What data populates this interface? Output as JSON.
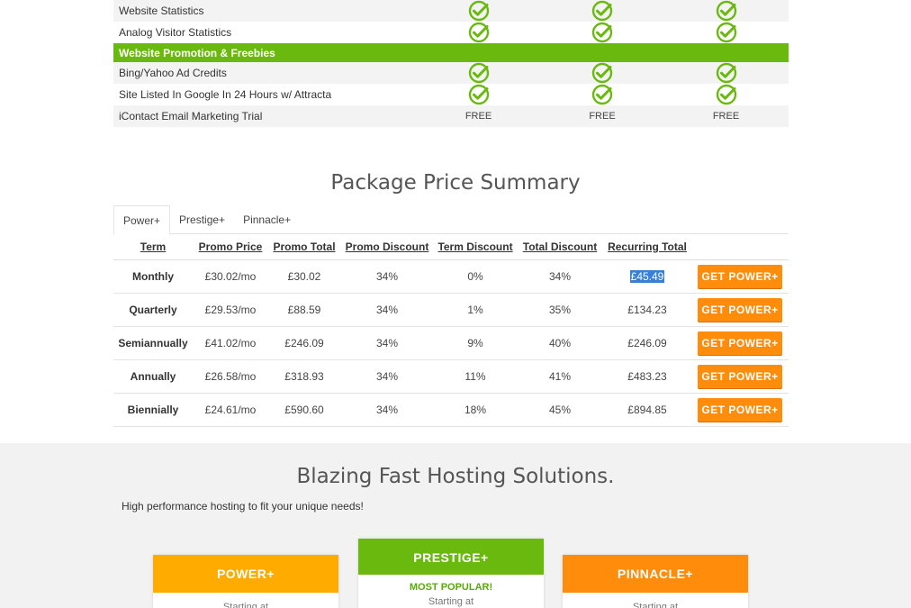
{
  "features": {
    "rows_top": [
      {
        "label": "Website Statistics",
        "cells": [
          "check",
          "check",
          "check"
        ],
        "bg": "alt"
      },
      {
        "label": "Analog Visitor Statistics",
        "cells": [
          "check",
          "check",
          "check"
        ],
        "bg": "white"
      }
    ],
    "section_label": "Website Promotion & Freebies",
    "rows_bottom": [
      {
        "label": "Bing/Yahoo Ad Credits",
        "cells": [
          "check",
          "check",
          "check"
        ],
        "bg": "alt"
      },
      {
        "label": "Site Listed In Google In 24 Hours w/ Attracta",
        "cells": [
          "check",
          "check",
          "check"
        ],
        "bg": "white"
      },
      {
        "label": "iContact Email Marketing Trial",
        "cells": [
          "FREE",
          "FREE",
          "FREE"
        ],
        "bg": "alt"
      }
    ]
  },
  "summary": {
    "title": "Package Price Summary",
    "tabs": [
      "Power+",
      "Prestige+",
      "Pinnacle+"
    ],
    "active_tab": 0,
    "columns": [
      "Term",
      "Promo Price",
      "Promo Total",
      "Promo Discount",
      "Term Discount",
      "Total Discount",
      "Recurring Total"
    ],
    "rows": [
      {
        "term": "Monthly",
        "promo_price": "£30.02/mo",
        "promo_total": "£30.02",
        "promo_discount": "34%",
        "term_discount": "0%",
        "total_discount": "34%",
        "recurring_total": "£45.49",
        "button": "GET POWER+"
      },
      {
        "term": "Quarterly",
        "promo_price": "£29.53/mo",
        "promo_total": "£88.59",
        "promo_discount": "34%",
        "term_discount": "1%",
        "total_discount": "35%",
        "recurring_total": "£134.23",
        "button": "GET POWER+"
      },
      {
        "term": "Semiannually",
        "promo_price": "£41.02/mo",
        "promo_total": "£246.09",
        "promo_discount": "34%",
        "term_discount": "9%",
        "total_discount": "40%",
        "recurring_total": "£246.09",
        "button": "GET POWER+"
      },
      {
        "term": "Annually",
        "promo_price": "£26.58/mo",
        "promo_total": "£318.93",
        "promo_discount": "34%",
        "term_discount": "11%",
        "total_discount": "41%",
        "recurring_total": "£483.23",
        "button": "GET POWER+"
      },
      {
        "term": "Biennially",
        "promo_price": "£24.61/mo",
        "promo_total": "£590.60",
        "promo_discount": "34%",
        "term_discount": "18%",
        "total_discount": "45%",
        "recurring_total": "£894.85",
        "button": "GET POWER+"
      }
    ]
  },
  "hosting": {
    "title": "Blazing Fast Hosting Solutions.",
    "subtitle": "High performance hosting to fit your unique needs!",
    "plans": [
      {
        "name": "POWER+",
        "color": "#ffab00",
        "badge": "",
        "starting": "Starting at"
      },
      {
        "name": "PRESTIGE+",
        "color": "#6ab90e",
        "badge": "MOST POPULAR!",
        "starting": "Starting at"
      },
      {
        "name": "PINNACLE+",
        "color": "#ff8c0a",
        "badge": "",
        "starting": "Starting at"
      }
    ]
  },
  "colors": {
    "green": "#6ab90e",
    "orange": "#ff8c0a",
    "yellow": "#ffab00",
    "selection": "#3a7fd6"
  }
}
